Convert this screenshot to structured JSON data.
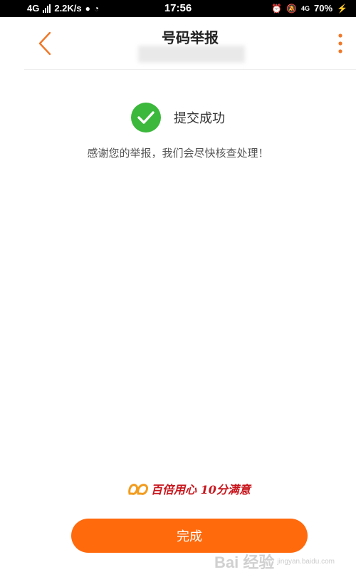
{
  "status_bar": {
    "network": "4G",
    "speed": "2.2K/s",
    "time": "17:56",
    "network_2": "4G",
    "battery": "70%"
  },
  "header": {
    "title": "号码举报"
  },
  "result": {
    "status_text": "提交成功",
    "message": "感谢您的举报，我们会尽快核查处理！"
  },
  "slogan": {
    "text": "百倍用心 10分满意"
  },
  "actions": {
    "done_label": "完成"
  },
  "watermark": {
    "text": "Bai 经验",
    "sub": "jingyan.baidu.com"
  },
  "colors": {
    "accent": "#ff6a0d",
    "success": "#3cb83c",
    "slogan": "#c8161d"
  },
  "icons": [
    "back-icon",
    "more-vertical-icon",
    "check-circle-icon",
    "wechat-icon",
    "weibo-icon",
    "alarm-icon",
    "mute-icon",
    "charging-icon"
  ]
}
